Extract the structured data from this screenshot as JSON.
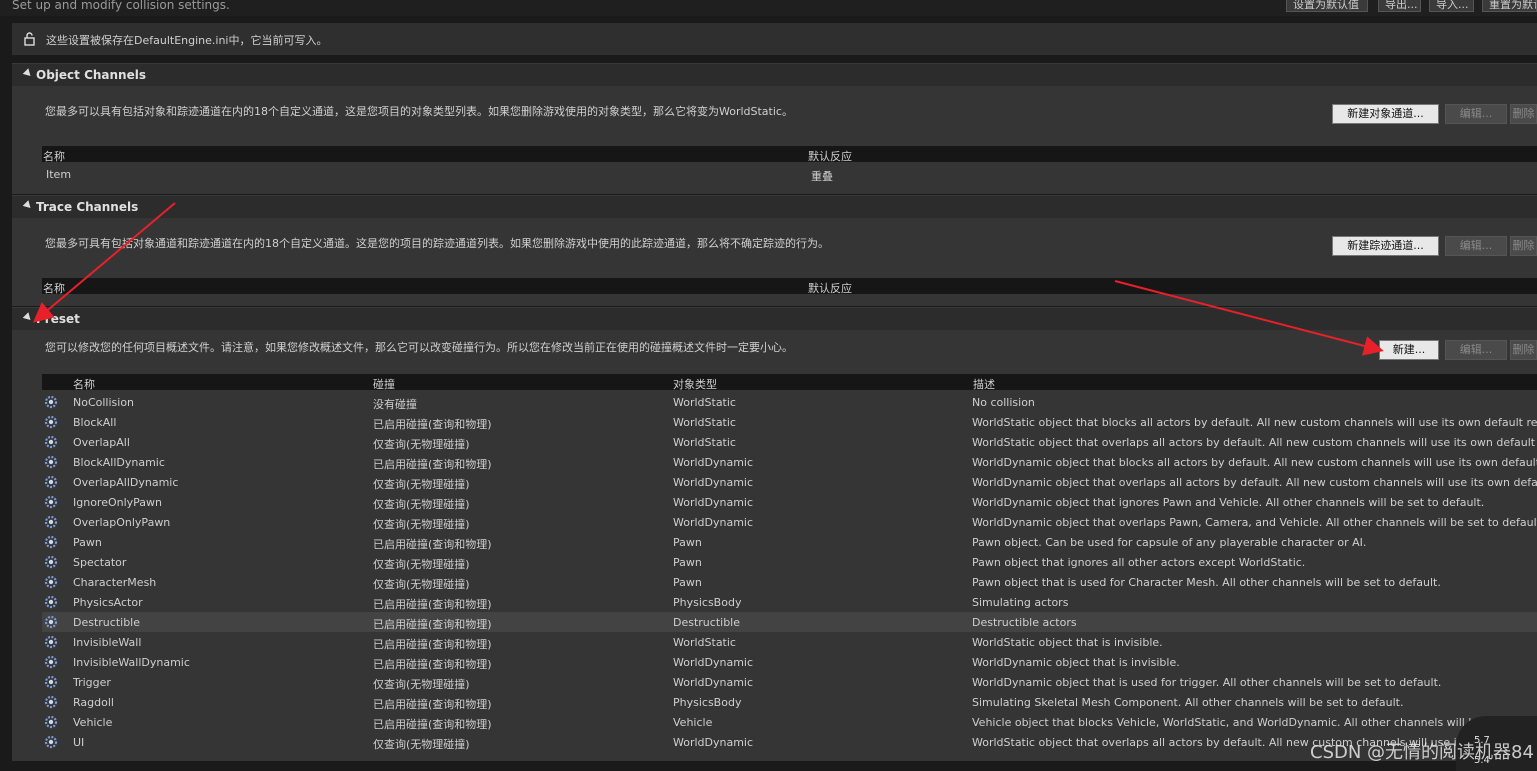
{
  "header": {
    "subtitle": "Set up and modify collision settings.",
    "buttons": [
      "设置为默认值",
      "导出...",
      "导入...",
      "重置为默认值"
    ]
  },
  "info": {
    "text": "这些设置被保存在DefaultEngine.ini中，它当前可写入。",
    "icon": "unlock-icon"
  },
  "object_channels": {
    "title": "Object Channels",
    "description": "您最多可以具有包括对象和踪迹通道在内的18个自定义通道，这是您项目的对象类型列表。如果您删除游戏使用的对象类型，那么它将变为WorldStatic。",
    "new_button": "新建对象通道...",
    "edit_button": "编辑...",
    "delete_button": "删除",
    "columns": [
      "名称",
      "默认反应"
    ],
    "rows": [
      {
        "name": "Item",
        "response": "重叠"
      }
    ]
  },
  "trace_channels": {
    "title": "Trace Channels",
    "description": "您最多可具有包括对象通道和踪迹通道在内的18个自定义通道。这是您的项目的踪迹通道列表。如果您删除游戏中使用的此踪迹通道，那么将不确定踪迹的行为。",
    "new_button": "新建踪迹通道...",
    "edit_button": "编辑...",
    "delete_button": "删除",
    "columns": [
      "名称",
      "默认反应"
    ]
  },
  "preset": {
    "title": "Preset",
    "description": "您可以修改您的任何项目概述文件。请注意，如果您修改概述文件，那么它可以改变碰撞行为。所以您在修改当前正在使用的碰撞概述文件时一定要小心。",
    "new_button": "新建...",
    "edit_button": "编辑...",
    "delete_button": "删除",
    "columns": [
      "名称",
      "碰撞",
      "对象类型",
      "描述"
    ],
    "rows": [
      {
        "name": "NoCollision",
        "collision": "没有碰撞",
        "type": "WorldStatic",
        "desc": "No collision"
      },
      {
        "name": "BlockAll",
        "collision": "已启用碰撞(查询和物理)",
        "type": "WorldStatic",
        "desc": "WorldStatic object that blocks all actors by default. All new custom channels will use its own default response."
      },
      {
        "name": "OverlapAll",
        "collision": "仅查询(无物理碰撞)",
        "type": "WorldStatic",
        "desc": "WorldStatic object that overlaps all actors by default. All new custom channels will use its own default response."
      },
      {
        "name": "BlockAllDynamic",
        "collision": "已启用碰撞(查询和物理)",
        "type": "WorldDynamic",
        "desc": "WorldDynamic object that blocks all actors by default. All new custom channels will use its own default response."
      },
      {
        "name": "OverlapAllDynamic",
        "collision": "仅查询(无物理碰撞)",
        "type": "WorldDynamic",
        "desc": "WorldDynamic object that overlaps all actors by default. All new custom channels will use its own default response."
      },
      {
        "name": "IgnoreOnlyPawn",
        "collision": "仅查询(无物理碰撞)",
        "type": "WorldDynamic",
        "desc": "WorldDynamic object that ignores Pawn and Vehicle. All other channels will be set to default."
      },
      {
        "name": "OverlapOnlyPawn",
        "collision": "仅查询(无物理碰撞)",
        "type": "WorldDynamic",
        "desc": "WorldDynamic object that overlaps Pawn, Camera, and Vehicle. All other channels will be set to default."
      },
      {
        "name": "Pawn",
        "collision": "已启用碰撞(查询和物理)",
        "type": "Pawn",
        "desc": "Pawn object. Can be used for capsule of any playerable character or AI."
      },
      {
        "name": "Spectator",
        "collision": "仅查询(无物理碰撞)",
        "type": "Pawn",
        "desc": "Pawn object that ignores all other actors except WorldStatic."
      },
      {
        "name": "CharacterMesh",
        "collision": "仅查询(无物理碰撞)",
        "type": "Pawn",
        "desc": "Pawn object that is used for Character Mesh. All other channels will be set to default."
      },
      {
        "name": "PhysicsActor",
        "collision": "已启用碰撞(查询和物理)",
        "type": "PhysicsBody",
        "desc": "Simulating actors"
      },
      {
        "name": "Destructible",
        "collision": "已启用碰撞(查询和物理)",
        "type": "Destructible",
        "desc": "Destructible actors",
        "selected": true
      },
      {
        "name": "InvisibleWall",
        "collision": "已启用碰撞(查询和物理)",
        "type": "WorldStatic",
        "desc": "WorldStatic object that is invisible."
      },
      {
        "name": "InvisibleWallDynamic",
        "collision": "已启用碰撞(查询和物理)",
        "type": "WorldDynamic",
        "desc": "WorldDynamic object that is invisible."
      },
      {
        "name": "Trigger",
        "collision": "仅查询(无物理碰撞)",
        "type": "WorldDynamic",
        "desc": "WorldDynamic object that is used for trigger. All other channels will be set to default."
      },
      {
        "name": "Ragdoll",
        "collision": "已启用碰撞(查询和物理)",
        "type": "PhysicsBody",
        "desc": "Simulating Skeletal Mesh Component. All other channels will be set to default."
      },
      {
        "name": "Vehicle",
        "collision": "已启用碰撞(查询和物理)",
        "type": "Vehicle",
        "desc": "Vehicle object that blocks Vehicle, WorldStatic, and WorldDynamic. All other channels will be set to default."
      },
      {
        "name": "UI",
        "collision": "仅查询(无物理碰撞)",
        "type": "WorldDynamic",
        "desc": "WorldStatic object that overlaps all actors by default. All new custom channels will use its own"
      }
    ]
  },
  "overlay": {
    "watermark": "CSDN @无情的阅读机器84",
    "fps_top": "5.7",
    "fps_bottom": "5.4"
  },
  "colors": {
    "accent_arrow": "#e8202a",
    "selected_row": "#434343"
  }
}
